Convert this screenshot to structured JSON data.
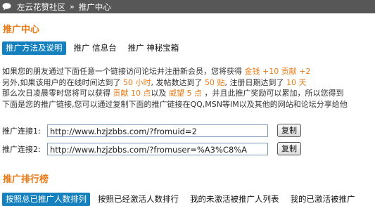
{
  "breadcrumb": {
    "site": "左云花赞社区",
    "separator": "»",
    "current": "推广中心"
  },
  "section1": {
    "title": "推广中心",
    "tabs": [
      {
        "label": "推广方法及说明",
        "active": true
      },
      {
        "label": "推广 信息台",
        "active": false
      },
      {
        "label": "推广 神秘宝箱",
        "active": false
      }
    ]
  },
  "info": {
    "l1": {
      "a": "如果您的朋友通过下面任意一个链接访问论坛并注册新会员，您将获得 ",
      "reward": "金钱 +10 贡献 +2"
    },
    "l2": {
      "a": "另外,如果该用户的在线时间达到了 ",
      "hours": "50 小时",
      "b": ", 发帖数达到了 ",
      "posts": "50 贴",
      "c": ", 注册日期达到了 ",
      "days": "10 天"
    },
    "l3": {
      "a": "那么次日凌晨零时您将可以获得 ",
      "bonus1": "贡献 10 点",
      "b": "以及 ",
      "bonus2": "威望 5 点",
      "c": " ，并且此推广奖励可以累加，所以您得到"
    },
    "l4": "下面是您的推广链接,您可以通过复制下面的推广链接在QQ,MSN等IM以及其他的网站和论坛分享给他"
  },
  "links": [
    {
      "label": "推广连接1:",
      "url": "http://www.hzjzbbs.com/?fromuid=2",
      "button": "复制"
    },
    {
      "label": "推广连接2:",
      "url": "http://www.hzjzbbs.com/?fromuser=%A3%C8%A",
      "button": "复制"
    }
  ],
  "section2": {
    "title": "推广排行榜",
    "tabs": [
      {
        "label": "按照总已推广人数排列",
        "active": true
      },
      {
        "label": "按照已经激活人数排行",
        "active": false
      },
      {
        "label": "我的未激活被推广人列表",
        "active": false
      },
      {
        "label": "我的已激活被推广",
        "active": false
      }
    ]
  },
  "colors": {
    "accent": "#e87a16",
    "tab_active": "#1580be",
    "topbar": "#575757"
  }
}
